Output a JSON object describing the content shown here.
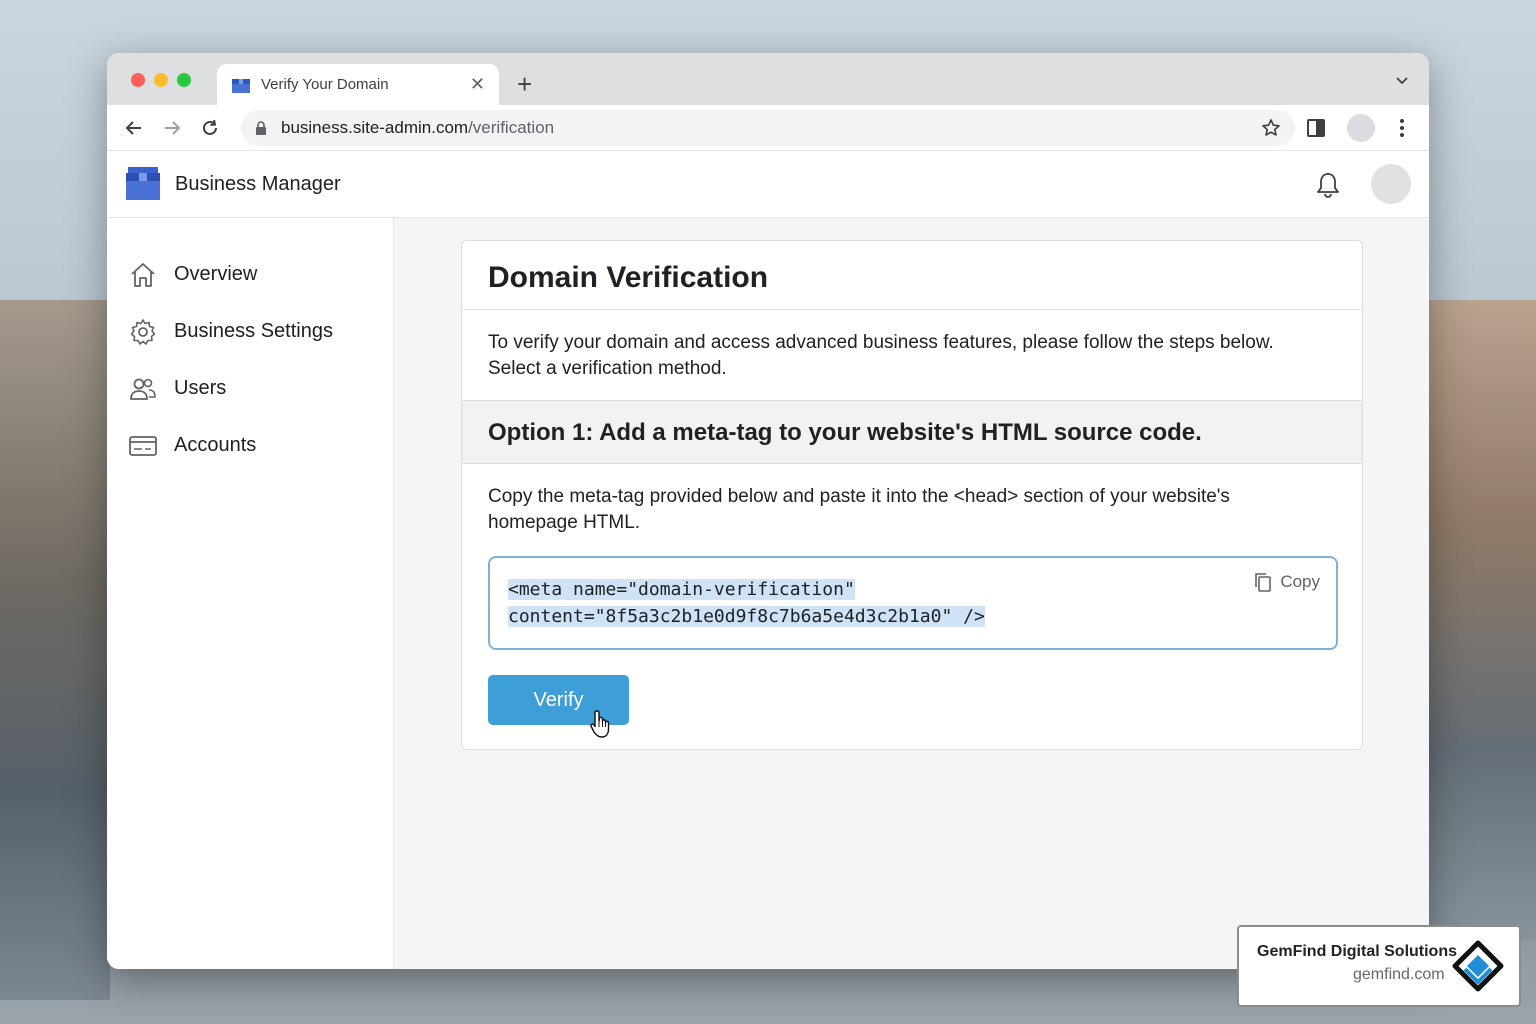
{
  "browser": {
    "tab_title": "Verify Your Domain",
    "url_host": "business.site-admin.com",
    "url_path": "/verification"
  },
  "app": {
    "title": "Business Manager"
  },
  "sidebar": {
    "items": [
      {
        "label": "Overview",
        "icon": "home-icon"
      },
      {
        "label": "Business Settings",
        "icon": "gear-icon"
      },
      {
        "label": "Users",
        "icon": "users-icon"
      },
      {
        "label": "Accounts",
        "icon": "card-icon"
      }
    ]
  },
  "card": {
    "title": "Domain Verification",
    "intro_line1": "To verify your domain and access advanced business features, please follow the steps below.",
    "intro_line2": "Select a verification method.",
    "option_title": "Option 1: Add a meta-tag to your website's HTML source code.",
    "option_desc_line1": "Copy the meta-tag provided below and paste it into the <head> section of your website's",
    "option_desc_line2": "homepage HTML.",
    "code_line1": "<meta name=\"domain-verification\"",
    "code_line2": "content=\"8f5a3c2b1e0d9f8c7b6a5e4d3c2b1a0\" />",
    "copy_label": "Copy",
    "verify_label": "Verify"
  },
  "watermark": {
    "name": "GemFind Digital Solutions",
    "url": "gemfind.com"
  },
  "colors": {
    "accent": "#3d9ed8",
    "code_highlight": "#cfe3f6",
    "code_border": "#7bb3dd"
  }
}
